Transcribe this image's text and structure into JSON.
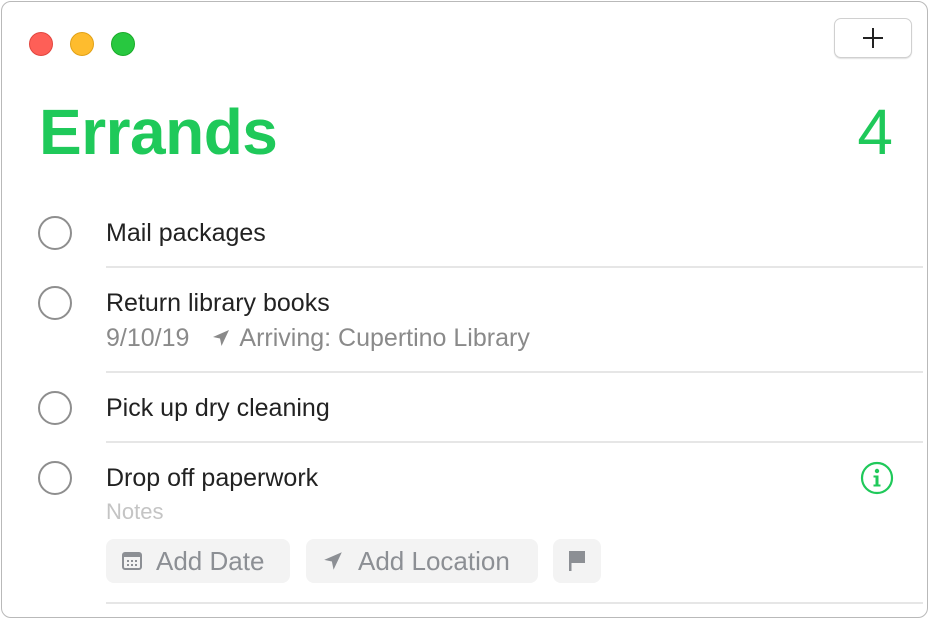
{
  "window": {
    "controls": [
      "close",
      "minimize",
      "zoom"
    ],
    "add_button_icon": "plus-icon"
  },
  "list": {
    "title": "Errands",
    "count": "4",
    "accent_color": "#1fc95a"
  },
  "reminders": [
    {
      "title": "Mail packages",
      "completed": false
    },
    {
      "title": "Return library books",
      "completed": false,
      "date": "9/10/19",
      "location_icon": "location-arrow-icon",
      "location": "Arriving: Cupertino Library"
    },
    {
      "title": "Pick up dry cleaning",
      "completed": false
    },
    {
      "title": "Drop off paperwork",
      "completed": false,
      "notes_placeholder": "Notes",
      "info_icon": "info-icon",
      "actions": {
        "add_date": "Add Date",
        "add_location": "Add Location",
        "flag_icon": "flag-icon"
      }
    }
  ]
}
